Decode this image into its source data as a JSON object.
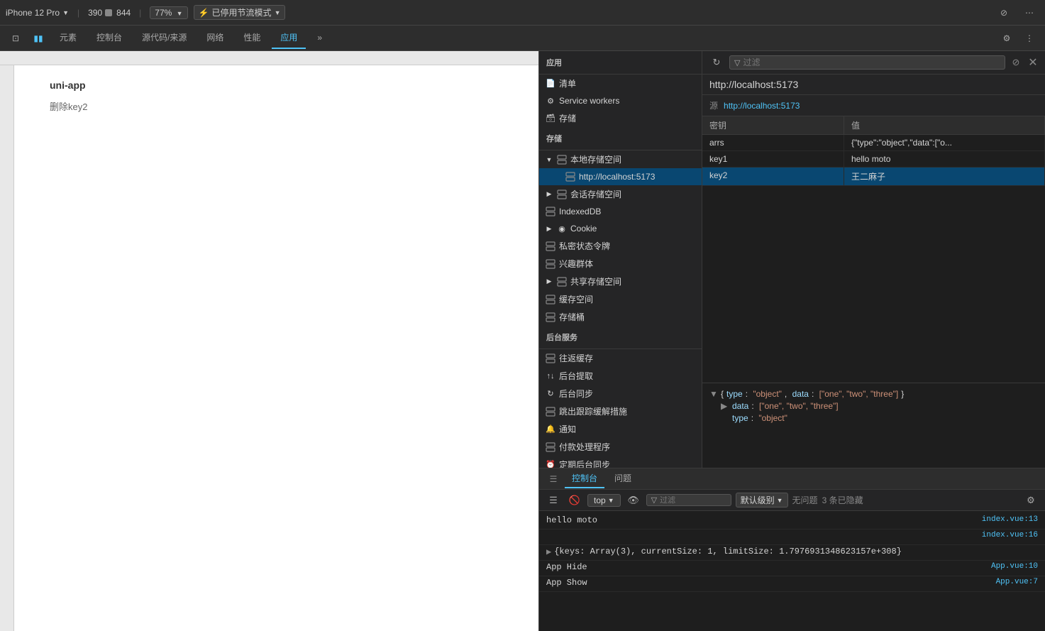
{
  "topToolbar": {
    "device": "iPhone 12 Pro",
    "width": "390",
    "height": "844",
    "closeLabel": "×",
    "zoom": "77%",
    "mode": "已停用节流模式",
    "moreIcon": "⋯",
    "toggleResponsive": "⇄",
    "zoomIcon": "⊡"
  },
  "devtoolsTabs": [
    {
      "label": "元素",
      "active": false
    },
    {
      "label": "控制台",
      "active": false
    },
    {
      "label": "源代码/来源",
      "active": false
    },
    {
      "label": "网络",
      "active": false
    },
    {
      "label": "性能",
      "active": false
    },
    {
      "label": "应用",
      "active": true
    },
    {
      "label": "»",
      "active": false
    }
  ],
  "sidebar": {
    "sections": [
      {
        "label": "应用",
        "items": [
          {
            "label": "清单",
            "icon": "📄",
            "indent": 0,
            "hasArrow": false
          },
          {
            "label": "Service workers",
            "icon": "⚙",
            "indent": 0,
            "hasArrow": false
          },
          {
            "label": "存储",
            "icon": "🗃",
            "indent": 0,
            "hasArrow": false
          }
        ]
      },
      {
        "label": "存储",
        "items": [
          {
            "label": "本地存储空间",
            "icon": "▦",
            "indent": 0,
            "hasArrow": true,
            "expanded": true
          },
          {
            "label": "http://localhost:5173",
            "icon": "▦",
            "indent": 1,
            "hasArrow": false,
            "selected": true
          },
          {
            "label": "会话存储空间",
            "icon": "▦",
            "indent": 0,
            "hasArrow": true,
            "expanded": false
          },
          {
            "label": "IndexedDB",
            "icon": "▦",
            "indent": 0,
            "hasArrow": false
          },
          {
            "label": "Cookie",
            "icon": "◉",
            "indent": 0,
            "hasArrow": true,
            "expanded": false
          },
          {
            "label": "私密状态令牌",
            "icon": "▦",
            "indent": 0,
            "hasArrow": false
          },
          {
            "label": "兴趣群体",
            "icon": "▦",
            "indent": 0,
            "hasArrow": false
          },
          {
            "label": "共享存储空间",
            "icon": "▦",
            "indent": 0,
            "hasArrow": true,
            "expanded": false
          },
          {
            "label": "缓存空间",
            "icon": "▦",
            "indent": 0,
            "hasArrow": false
          },
          {
            "label": "存储桶",
            "icon": "▦",
            "indent": 0,
            "hasArrow": false
          }
        ]
      },
      {
        "label": "后台服务",
        "items": [
          {
            "label": "往返缓存",
            "icon": "▦",
            "indent": 0,
            "hasArrow": false
          },
          {
            "label": "后台提取",
            "icon": "↑↓",
            "indent": 0,
            "hasArrow": false
          },
          {
            "label": "后台同步",
            "icon": "↻",
            "indent": 0,
            "hasArrow": false
          },
          {
            "label": "跳出跟踪缓解措施",
            "icon": "▦",
            "indent": 0,
            "hasArrow": false
          },
          {
            "label": "通知",
            "icon": "🔔",
            "indent": 0,
            "hasArrow": false
          },
          {
            "label": "付款处理程序",
            "icon": "▦",
            "indent": 0,
            "hasArrow": false
          },
          {
            "label": "定期后台同步",
            "icon": "⏰",
            "indent": 0,
            "hasArrow": false
          }
        ]
      }
    ]
  },
  "filterBar": {
    "refreshIcon": "↻",
    "filterLabel": "过滤",
    "cancelIcon": "⊘",
    "closeIcon": "✕"
  },
  "urlBar": {
    "url": "http://localhost:5173"
  },
  "sourceInfo": {
    "label": "源",
    "value": "http://localhost:5173"
  },
  "tableHeaders": {
    "key": "密钥",
    "value": "值"
  },
  "tableRows": [
    {
      "key": "arrs",
      "value": "{\"type\":\"object\",\"data\":[\"o...",
      "selected": false
    },
    {
      "key": "key1",
      "value": "hello moto",
      "selected": false
    },
    {
      "key": "key2",
      "value": "王二麻子",
      "selected": true
    }
  ],
  "previewSection": {
    "mainText": "{type: \"object\", data: [\"one\", \"two\", \"three\"]}",
    "dataLine": "data: [\"one\", \"two\", \"three\"]",
    "typeLine": "type: \"object\""
  },
  "consoleTabs": [
    {
      "label": "控制台",
      "active": true
    },
    {
      "label": "问题",
      "active": false
    }
  ],
  "consoleToolbar": {
    "menuIcon": "☰",
    "clearIcon": "🚫",
    "topLabel": "top",
    "eyeIcon": "👁",
    "filterLabel": "过滤",
    "filterPlaceholder": "",
    "levelLabel": "默认级别",
    "noIssues": "无问题",
    "hiddenCount": "3 条已隐藏"
  },
  "consoleLines": [
    {
      "text": "hello moto",
      "link": "index.vue:13",
      "expandable": false
    },
    {
      "text": "",
      "link": "index.vue:16",
      "expandable": false
    },
    {
      "expand": true,
      "text": "{keys: Array(3), currentSize: 1, limitSize: 1.7976931348623157e+308}",
      "link": "",
      "expandable": true
    },
    {
      "text": "App Hide",
      "link": "App.vue:10",
      "expandable": false
    },
    {
      "text": "App Show",
      "link": "App.vue:7",
      "expandable": false
    }
  ],
  "phoneApp": {
    "title": "uni-app",
    "deleteText": "删除key2"
  }
}
